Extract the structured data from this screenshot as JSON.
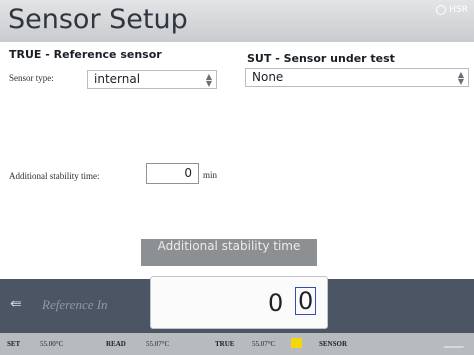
{
  "header": {
    "title": "Sensor Setup",
    "top_right_text": "HSR"
  },
  "true_section": {
    "heading": "TRUE - Reference sensor",
    "sensor_type_label": "Sensor type:",
    "sensor_type_value": "internal"
  },
  "sut_section": {
    "heading": "SUT - Sensor under test",
    "value": "None"
  },
  "stability": {
    "label": "Additional stability time:",
    "value": "0",
    "unit": "min"
  },
  "popup": {
    "title": "Additional stability time",
    "digit_1": "0",
    "digit_2": "0"
  },
  "bottom": {
    "reference_button": "Reference In"
  },
  "status": {
    "set_label": "SET",
    "set_value": "55.00°C",
    "read_label": "READ",
    "read_value": "55.07°C",
    "true_label": "TRUE",
    "true_value": "55.07°C",
    "sensor_label": "SENSOR"
  }
}
